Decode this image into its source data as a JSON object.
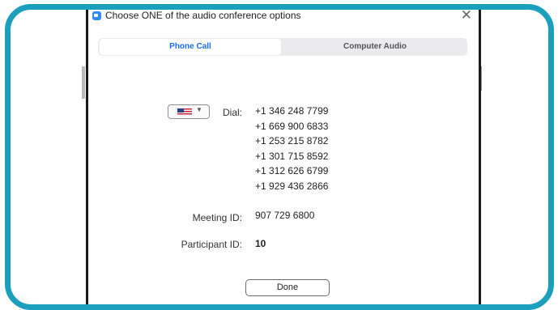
{
  "window": {
    "title": "Choose ONE of the audio conference options",
    "close_glyph": "✕"
  },
  "tabs": [
    {
      "label": "Phone Call",
      "active": true
    },
    {
      "label": "Computer Audio",
      "active": false
    }
  ],
  "dial": {
    "country_flag": "us-flag-icon",
    "label": "Dial:",
    "numbers": [
      "+1 346 248 7799",
      "+1 669 900 6833",
      "+1 253 215 8782",
      "+1 301 715 8592",
      "+1 312 626 6799",
      "+1 929 436 2866"
    ]
  },
  "meeting": {
    "label": "Meeting ID:",
    "value": "907 729 6800"
  },
  "participant": {
    "label": "Participant ID:",
    "value": "10"
  },
  "done_label": "Done",
  "colors": {
    "frame_border": "#1a9fbd",
    "active_tab_text": "#1b6ee6",
    "app_icon": "#2d8cff"
  }
}
